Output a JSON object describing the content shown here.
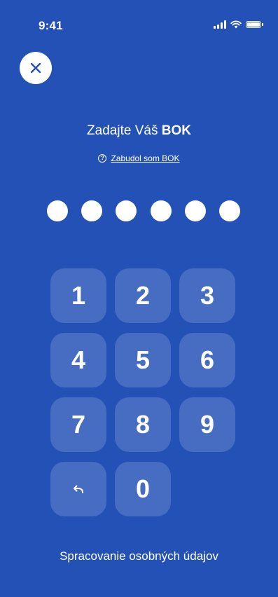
{
  "status_bar": {
    "time": "9:41",
    "signal_icon": "cellular-signal-icon",
    "wifi_icon": "wifi-icon",
    "battery_icon": "battery-icon"
  },
  "close_icon": "close-icon",
  "title": {
    "prefix": "Zadajte Váš ",
    "bold": "BOK"
  },
  "forgot_link": {
    "icon": "help-circle-icon",
    "icon_glyph": "?",
    "label": "Zabudol som BOK"
  },
  "pin": {
    "length": 6,
    "filled": 6
  },
  "keypad": {
    "keys": [
      "1",
      "2",
      "3",
      "4",
      "5",
      "6",
      "7",
      "8",
      "9"
    ],
    "back_icon": "backspace-arrow-icon",
    "zero": "0"
  },
  "privacy_link": "Spracovanie osobných údajov",
  "colors": {
    "background": "#2351b6",
    "key_background": "rgba(255,255,255,0.16)",
    "text": "#ffffff"
  }
}
